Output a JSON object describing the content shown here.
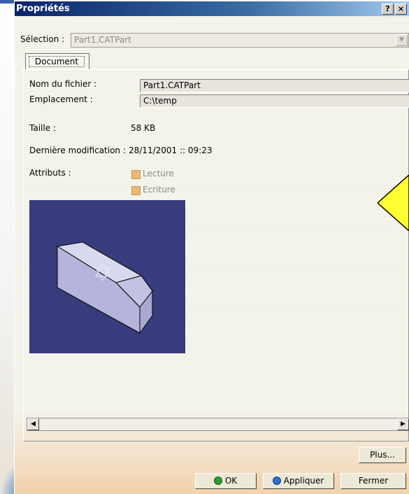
{
  "window": {
    "title": "Propriétés",
    "help_glyph": "?",
    "close_glyph": "×"
  },
  "selection": {
    "label": "Sélection :",
    "value": "Part1.CATPart"
  },
  "tabs": [
    {
      "label": "Document",
      "active": true
    }
  ],
  "document": {
    "filename_label": "Nom du fichier :",
    "filename_value": "Part1.CATPart",
    "location_label": "Emplacement :",
    "location_value": "C:\\temp",
    "size_label": "Taille :",
    "size_value": "58 KB",
    "modified_label": "Dernière modification :",
    "modified_value": "28/11/2001 :: 09:23",
    "attributes_label": "Attributs :",
    "attributes": [
      {
        "label": "Lecture",
        "checked": true,
        "disabled": true
      },
      {
        "label": "Ecriture",
        "checked": true,
        "disabled": true
      }
    ],
    "preview_background": "#383c7c"
  },
  "buttons": {
    "more": "Plus...",
    "ok": "OK",
    "apply": "Appliquer",
    "close": "Fermer"
  },
  "colors": {
    "ok_dot": "#2e9e2e",
    "apply_dot": "#2e6fd0",
    "title_gradient_start": "#0a246a"
  }
}
